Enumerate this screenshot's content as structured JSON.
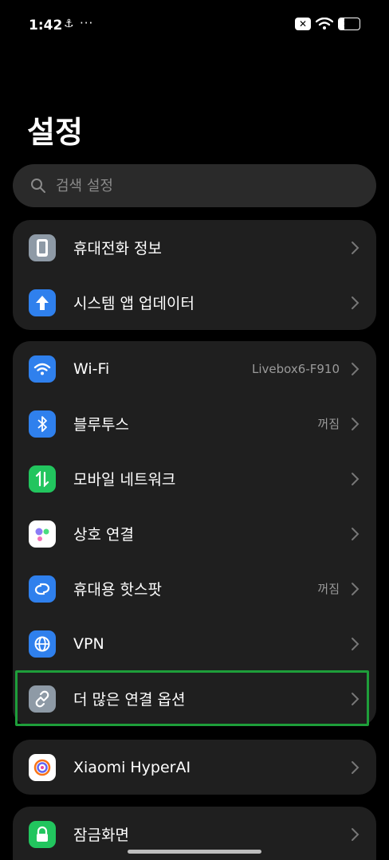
{
  "status": {
    "time": "1:42",
    "dots": "···",
    "battery": "27",
    "battery_level": 0.27
  },
  "title": "설정",
  "search": {
    "placeholder": "검색 설정"
  },
  "groups": {
    "g1": [
      {
        "label": "휴대전화 정보",
        "icon": "phone-icon",
        "color": "#8e9aa6"
      },
      {
        "label": "시스템 앱 업데이터",
        "icon": "arrow-up-icon",
        "color": "#2f80ed"
      }
    ],
    "g2": [
      {
        "label": "Wi-Fi",
        "value": "Livebox6-F910",
        "icon": "wifi-icon",
        "color": "#2f80ed"
      },
      {
        "label": "블루투스",
        "value": "꺼짐",
        "icon": "bluetooth-icon",
        "color": "#2f80ed"
      },
      {
        "label": "모바일 네트워크",
        "icon": "mobile-network-icon",
        "color": "#22c55e"
      },
      {
        "label": "상호 연결",
        "icon": "interconnect-icon",
        "color": "#ffffff"
      },
      {
        "label": "휴대용 핫스팟",
        "value": "꺼짐",
        "icon": "hotspot-icon",
        "color": "#2f80ed"
      },
      {
        "label": "VPN",
        "icon": "globe-icon",
        "color": "#2f80ed"
      },
      {
        "label": "더 많은 연결 옵션",
        "icon": "link-icon",
        "color": "#8e9aa6"
      }
    ],
    "g3": [
      {
        "label": "Xiaomi HyperAI",
        "icon": "hyperai-icon",
        "color": "#ffffff"
      }
    ],
    "g4": [
      {
        "label": "잠금화면",
        "icon": "lock-icon",
        "color": "#22c55e"
      }
    ]
  }
}
